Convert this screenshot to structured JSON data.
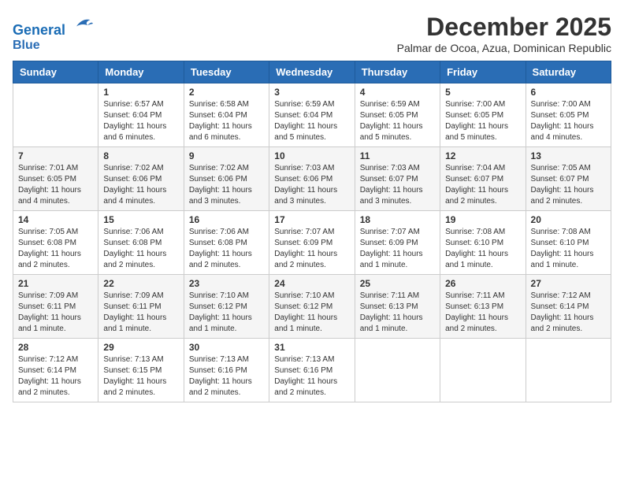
{
  "header": {
    "logo_line1": "General",
    "logo_line2": "Blue",
    "month": "December 2025",
    "location": "Palmar de Ocoa, Azua, Dominican Republic"
  },
  "days_of_week": [
    "Sunday",
    "Monday",
    "Tuesday",
    "Wednesday",
    "Thursday",
    "Friday",
    "Saturday"
  ],
  "weeks": [
    [
      {
        "day": "",
        "info": ""
      },
      {
        "day": "1",
        "info": "Sunrise: 6:57 AM\nSunset: 6:04 PM\nDaylight: 11 hours\nand 6 minutes."
      },
      {
        "day": "2",
        "info": "Sunrise: 6:58 AM\nSunset: 6:04 PM\nDaylight: 11 hours\nand 6 minutes."
      },
      {
        "day": "3",
        "info": "Sunrise: 6:59 AM\nSunset: 6:04 PM\nDaylight: 11 hours\nand 5 minutes."
      },
      {
        "day": "4",
        "info": "Sunrise: 6:59 AM\nSunset: 6:05 PM\nDaylight: 11 hours\nand 5 minutes."
      },
      {
        "day": "5",
        "info": "Sunrise: 7:00 AM\nSunset: 6:05 PM\nDaylight: 11 hours\nand 5 minutes."
      },
      {
        "day": "6",
        "info": "Sunrise: 7:00 AM\nSunset: 6:05 PM\nDaylight: 11 hours\nand 4 minutes."
      }
    ],
    [
      {
        "day": "7",
        "info": "Sunrise: 7:01 AM\nSunset: 6:05 PM\nDaylight: 11 hours\nand 4 minutes."
      },
      {
        "day": "8",
        "info": "Sunrise: 7:02 AM\nSunset: 6:06 PM\nDaylight: 11 hours\nand 4 minutes."
      },
      {
        "day": "9",
        "info": "Sunrise: 7:02 AM\nSunset: 6:06 PM\nDaylight: 11 hours\nand 3 minutes."
      },
      {
        "day": "10",
        "info": "Sunrise: 7:03 AM\nSunset: 6:06 PM\nDaylight: 11 hours\nand 3 minutes."
      },
      {
        "day": "11",
        "info": "Sunrise: 7:03 AM\nSunset: 6:07 PM\nDaylight: 11 hours\nand 3 minutes."
      },
      {
        "day": "12",
        "info": "Sunrise: 7:04 AM\nSunset: 6:07 PM\nDaylight: 11 hours\nand 2 minutes."
      },
      {
        "day": "13",
        "info": "Sunrise: 7:05 AM\nSunset: 6:07 PM\nDaylight: 11 hours\nand 2 minutes."
      }
    ],
    [
      {
        "day": "14",
        "info": "Sunrise: 7:05 AM\nSunset: 6:08 PM\nDaylight: 11 hours\nand 2 minutes."
      },
      {
        "day": "15",
        "info": "Sunrise: 7:06 AM\nSunset: 6:08 PM\nDaylight: 11 hours\nand 2 minutes."
      },
      {
        "day": "16",
        "info": "Sunrise: 7:06 AM\nSunset: 6:08 PM\nDaylight: 11 hours\nand 2 minutes."
      },
      {
        "day": "17",
        "info": "Sunrise: 7:07 AM\nSunset: 6:09 PM\nDaylight: 11 hours\nand 2 minutes."
      },
      {
        "day": "18",
        "info": "Sunrise: 7:07 AM\nSunset: 6:09 PM\nDaylight: 11 hours\nand 1 minute."
      },
      {
        "day": "19",
        "info": "Sunrise: 7:08 AM\nSunset: 6:10 PM\nDaylight: 11 hours\nand 1 minute."
      },
      {
        "day": "20",
        "info": "Sunrise: 7:08 AM\nSunset: 6:10 PM\nDaylight: 11 hours\nand 1 minute."
      }
    ],
    [
      {
        "day": "21",
        "info": "Sunrise: 7:09 AM\nSunset: 6:11 PM\nDaylight: 11 hours\nand 1 minute."
      },
      {
        "day": "22",
        "info": "Sunrise: 7:09 AM\nSunset: 6:11 PM\nDaylight: 11 hours\nand 1 minute."
      },
      {
        "day": "23",
        "info": "Sunrise: 7:10 AM\nSunset: 6:12 PM\nDaylight: 11 hours\nand 1 minute."
      },
      {
        "day": "24",
        "info": "Sunrise: 7:10 AM\nSunset: 6:12 PM\nDaylight: 11 hours\nand 1 minute."
      },
      {
        "day": "25",
        "info": "Sunrise: 7:11 AM\nSunset: 6:13 PM\nDaylight: 11 hours\nand 1 minute."
      },
      {
        "day": "26",
        "info": "Sunrise: 7:11 AM\nSunset: 6:13 PM\nDaylight: 11 hours\nand 2 minutes."
      },
      {
        "day": "27",
        "info": "Sunrise: 7:12 AM\nSunset: 6:14 PM\nDaylight: 11 hours\nand 2 minutes."
      }
    ],
    [
      {
        "day": "28",
        "info": "Sunrise: 7:12 AM\nSunset: 6:14 PM\nDaylight: 11 hours\nand 2 minutes."
      },
      {
        "day": "29",
        "info": "Sunrise: 7:13 AM\nSunset: 6:15 PM\nDaylight: 11 hours\nand 2 minutes."
      },
      {
        "day": "30",
        "info": "Sunrise: 7:13 AM\nSunset: 6:16 PM\nDaylight: 11 hours\nand 2 minutes."
      },
      {
        "day": "31",
        "info": "Sunrise: 7:13 AM\nSunset: 6:16 PM\nDaylight: 11 hours\nand 2 minutes."
      },
      {
        "day": "",
        "info": ""
      },
      {
        "day": "",
        "info": ""
      },
      {
        "day": "",
        "info": ""
      }
    ]
  ]
}
